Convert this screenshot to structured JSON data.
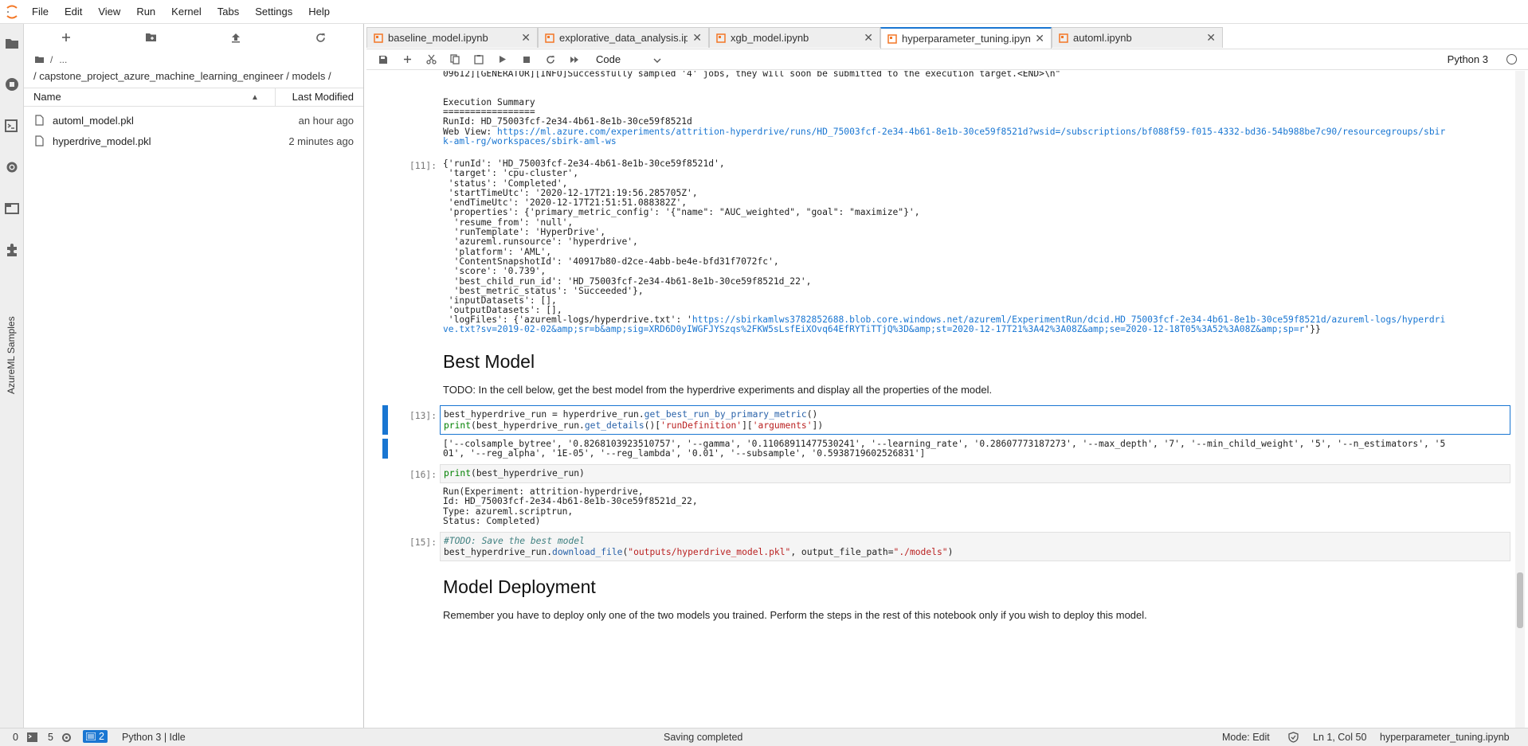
{
  "menu": [
    "File",
    "Edit",
    "View",
    "Run",
    "Kernel",
    "Tabs",
    "Settings",
    "Help"
  ],
  "activity_bar": {
    "icons": [
      "folder-icon",
      "running-icon",
      "commands-icon",
      "property-inspector-icon",
      "tabs-icon",
      "extension-icon"
    ],
    "azureml_label": "AzureML Samples"
  },
  "file_browser": {
    "breadcrumb_root": "/",
    "breadcrumb_ellipsis": "...",
    "path": "/ capstone_project_azure_machine_learning_engineer / models /",
    "header_name": "Name",
    "header_modified": "Last Modified",
    "files": [
      {
        "name": "automl_model.pkl",
        "modified": "an hour ago"
      },
      {
        "name": "hyperdrive_model.pkl",
        "modified": "2 minutes ago"
      }
    ]
  },
  "tabs": [
    {
      "label": "baseline_model.ipynb",
      "active": false
    },
    {
      "label": "explorative_data_analysis.ipy",
      "active": false
    },
    {
      "label": "xgb_model.ipynb",
      "active": false
    },
    {
      "label": "hyperparameter_tuning.ipynl",
      "active": true
    },
    {
      "label": "automl.ipynb",
      "active": false
    }
  ],
  "toolbar": {
    "cell_type": "Code",
    "kernel": "Python 3"
  },
  "notebook": {
    "top_line": "09612][GENERATOR][INFO]Successfully sampled '4' jobs, they will soon be submitted to the execution target.<END>\\n\"",
    "exec_summary_title": "Execution Summary",
    "exec_summary_rule": "=================",
    "run_id_line": "RunId: HD_75003fcf-2e34-4b61-8e1b-30ce59f8521d",
    "web_view_label": "Web View: ",
    "web_view_url_1": "https://ml.azure.com/experiments/attrition-hyperdrive/runs/HD_75003fcf-2e34-4b61-8e1b-30ce59f8521d?wsid=/subscriptions/bf088f59-f015-4332-bd36-54b988be7c90/resourcegroups/sbir",
    "web_view_url_2": "k-aml-rg/workspaces/sbirk-aml-ws",
    "prompt_11": "[11]:",
    "details_lines": [
      "{'runId': 'HD_75003fcf-2e34-4b61-8e1b-30ce59f8521d',",
      " 'target': 'cpu-cluster',",
      " 'status': 'Completed',",
      " 'startTimeUtc': '2020-12-17T21:19:56.285705Z',",
      " 'endTimeUtc': '2020-12-17T21:51:51.088382Z',",
      " 'properties': {'primary_metric_config': '{\"name\": \"AUC_weighted\", \"goal\": \"maximize\"}',",
      "  'resume_from': 'null',",
      "  'runTemplate': 'HyperDrive',",
      "  'azureml.runsource': 'hyperdrive',",
      "  'platform': 'AML',",
      "  'ContentSnapshotId': '40917b80-d2ce-4abb-be4e-bfd31f7072fc',",
      "  'score': '0.739',",
      "  'best_child_run_id': 'HD_75003fcf-2e34-4b61-8e1b-30ce59f8521d_22',",
      "  'best_metric_status': 'Succeeded'},",
      " 'inputDatasets': [],",
      " 'outputDatasets': [],"
    ],
    "logfiles_prefix": " 'logFiles': {'azureml-logs/hyperdrive.txt': '",
    "logfiles_url_1": "https://sbirkamlws3782852688.blob.core.windows.net/azureml/ExperimentRun/dcid.HD_75003fcf-2e34-4b61-8e1b-30ce59f8521d/azureml-logs/hyperdri",
    "logfiles_url_2": "ve.txt?sv=2019-02-02&amp;sr=b&amp;sig=XRD6D0yIWGFJYSzqs%2FKW5sLsfEiXOvq64EfRYTiTTjQ%3D&amp;st=2020-12-17T21%3A42%3A08Z&amp;se=2020-12-18T05%3A52%3A08Z&amp;sp=r",
    "logfiles_suffix": "'}}",
    "best_model_heading": "Best Model",
    "best_model_todo": "TODO: In the cell below, get the best model from the hyperdrive experiments and display all the properties of the model.",
    "prompt_13": "[13]:",
    "cell13_line1_a": "best_hyperdrive_run = hyperdrive_run.",
    "cell13_line1_fn": "get_best_run_by_primary_metric",
    "cell13_line1_b": "()",
    "cell13_line2_print": "print",
    "cell13_line2_a": "(best_hyperdrive_run.",
    "cell13_line2_fn": "get_details",
    "cell13_line2_b": "()[",
    "cell13_line2_s1": "'runDefinition'",
    "cell13_line2_c": "][",
    "cell13_line2_s2": "'arguments'",
    "cell13_line2_d": "])",
    "out13_line1": "['--colsample_bytree', '0.8268103923510757', '--gamma', '0.11068911477530241', '--learning_rate', '0.28607773187273', '--max_depth', '7', '--min_child_weight', '5', '--n_estimators', '5",
    "out13_line2": "01', '--reg_alpha', '1E-05', '--reg_lambda', '0.01', '--subsample', '0.5938719602526831']",
    "prompt_16": "[16]:",
    "cell16_print": "print",
    "cell16_rest": "(best_hyperdrive_run)",
    "out16_lines": [
      "Run(Experiment: attrition-hyperdrive,",
      "Id: HD_75003fcf-2e34-4b61-8e1b-30ce59f8521d_22,",
      "Type: azureml.scriptrun,",
      "Status: Completed)"
    ],
    "prompt_15": "[15]:",
    "cell15_comment": "#TODO: Save the best model",
    "cell15_a": "best_hyperdrive_run.",
    "cell15_fn": "download_file",
    "cell15_b": "(",
    "cell15_s1": "\"outputs/hyperdrive_model.pkl\"",
    "cell15_c": ", output_file_path=",
    "cell15_s2": "\"./models\"",
    "cell15_d": ")",
    "deploy_heading": "Model Deployment",
    "deploy_text": "Remember you have to deploy only one of the two models you trained. Perform the steps in the rest of this notebook only if you wish to deploy this model."
  },
  "statusbar": {
    "count_a": "0",
    "count_b": "5",
    "tabs_count": "2",
    "kernel_state": "Python 3 | Idle",
    "saving": "Saving completed",
    "mode": "Mode: Edit",
    "position": "Ln 1, Col 50",
    "filename": "hyperparameter_tuning.ipynb"
  },
  "colors": {
    "accent": "#1976d2",
    "notebook_icon": "#f37726",
    "string": "#ba2121",
    "keyword": "#008000"
  }
}
